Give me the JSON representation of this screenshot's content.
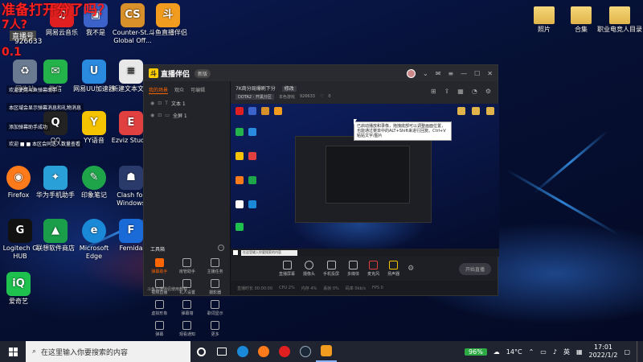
{
  "overlay": {
    "line1": "准备打开分了吗？",
    "line2": "7人?",
    "line3": "0.1",
    "badge": "直播号",
    "room_id": "926633"
  },
  "desktop_icons": [
    {
      "label": "网易云音乐",
      "color": "#e02020",
      "glyph": "♫"
    },
    {
      "label": "我不是",
      "color": "#3b63c9",
      "glyph": "▣"
    },
    {
      "label": "Counter-St... Global Off...",
      "color": "#d8902a",
      "glyph": "CS"
    },
    {
      "label": "斗鱼直播伴侣",
      "color": "#f29c1f",
      "glyph": "斗"
    },
    {
      "label": "回收站",
      "color": "#6a7a90",
      "glyph": "♻"
    },
    {
      "label": "微信",
      "color": "#24b24a",
      "glyph": "✉"
    },
    {
      "label": "网易UU加速器",
      "color": "#2a8ae0",
      "glyph": "U"
    },
    {
      "label": "新建文本文件",
      "color": "#e8e8e8",
      "glyph": "≡"
    },
    {
      "label": "QQ",
      "color": "#222",
      "glyph": "Q"
    },
    {
      "label": "YY语音",
      "color": "#f5c300",
      "glyph": "Y"
    },
    {
      "label": "Ezviz Studio",
      "color": "#e04040",
      "glyph": "E"
    },
    {
      "label": "Firefox",
      "color": "#ff7a1a",
      "glyph": "◉"
    },
    {
      "label": "华为手机助手",
      "color": "#2aa0d8",
      "glyph": "✦"
    },
    {
      "label": "印象笔记",
      "color": "#1ea54a",
      "glyph": "✎"
    },
    {
      "label": "Clash for Windows",
      "color": "#2a3a6a",
      "glyph": "☗"
    },
    {
      "label": "Logitech G HUB",
      "color": "#111",
      "glyph": "G"
    },
    {
      "label": "联想软件商店",
      "color": "#1a9e4a",
      "glyph": "▲"
    },
    {
      "label": "Microsoft Edge",
      "color": "#1a8ad8",
      "glyph": "e"
    },
    {
      "label": "Femida",
      "color": "#1a6ad8",
      "glyph": "F"
    },
    {
      "label": "爱奇艺",
      "color": "#1fc14e",
      "glyph": "iQ"
    },
    {
      "label": "照片",
      "color": "#e0b44a",
      "glyph": ""
    },
    {
      "label": "合集",
      "color": "#e0b44a",
      "glyph": ""
    },
    {
      "label": "职业电竞人目录",
      "color": "#e0b44a",
      "glyph": ""
    }
  ],
  "notices": [
    "欢迎使用斗鱼弹幕助手",
    "本区域会显示弹幕消息和礼物消息",
    "添加弹幕助手成功",
    "欢迎 ■ ■ 本区会同送人数量查看"
  ],
  "window": {
    "app_name": "直播伴侣",
    "version": "新版",
    "left_tabs": [
      "我的场景",
      "观众",
      "可编辑"
    ],
    "scenes": [
      {
        "label": "文本 1"
      },
      {
        "label": "全屏 1"
      }
    ],
    "tools_title": "工具箱",
    "tools_more": "···",
    "tools": [
      "弹幕助手",
      "房管助手",
      "主播任务",
      "视频直播",
      "礼人设置",
      "摄影器",
      "虚拟形象",
      "弹幕墙",
      "歌词显示",
      "弹幕",
      "观看通知",
      "更多"
    ],
    "left_footer": "斗鱼直播伴侣使用教程",
    "room_title": "7K商分局爆刷下分",
    "edit_label": "修改",
    "category": "DOTA2 · 开黑分区",
    "room_label": "本色游戏",
    "room_number": "926633",
    "likes": "0",
    "tooltip": "已启动播放和录像，拖拽底部可以调整画面位置，也能通过菜单中的ALT+Shift来进行回复。Ctrl+V粘贴文字/图片",
    "preview_search": "在这里输入你要搜索的内容",
    "controls": [
      "直播屏幕",
      "摄像头",
      "手机投屏",
      "多媒体",
      "麦克风",
      "扬声器"
    ],
    "go_live": "开始直播",
    "status": [
      "直播时长 00:00:00",
      "CPU 2%",
      "内存 4%",
      "丢帧 0%",
      "码率 0kb/s",
      "FPS 0"
    ]
  },
  "taskbar": {
    "search_placeholder": "在这里输入你要搜索的内容",
    "battery": "96%",
    "temp": "14°C",
    "lang": "英",
    "time": "17:01",
    "date": "2022/1/2"
  }
}
